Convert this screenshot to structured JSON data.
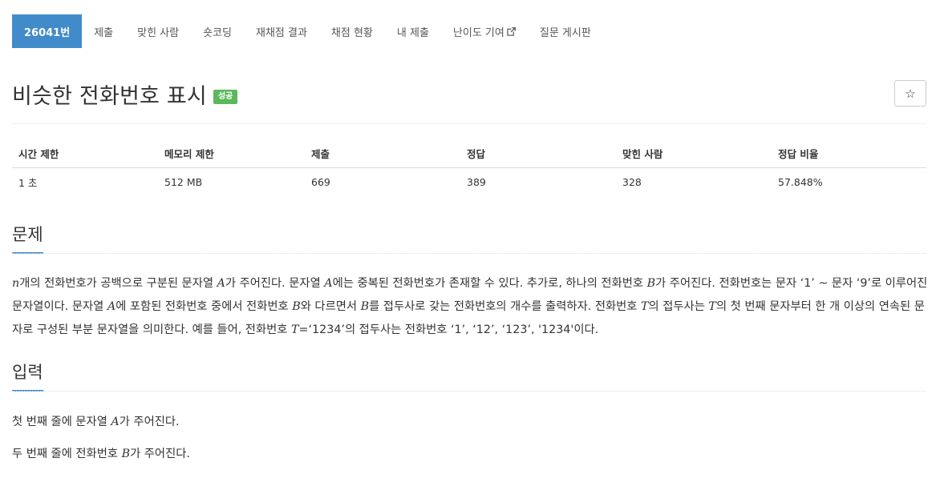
{
  "nav": {
    "items": [
      {
        "label": "26041번",
        "active": true
      },
      {
        "label": "제출"
      },
      {
        "label": "맞힌 사람"
      },
      {
        "label": "숏코딩"
      },
      {
        "label": "재채점 결과"
      },
      {
        "label": "채점 현황"
      },
      {
        "label": "내 제출"
      },
      {
        "label": "난이도 기여",
        "external": true
      },
      {
        "label": "질문 게시판"
      }
    ]
  },
  "problem": {
    "title": "비슷한 전화번호 표시",
    "status_badge": "성공",
    "star_icon": "star-outline-icon"
  },
  "info_table": {
    "headers": [
      "시간 제한",
      "메모리 제한",
      "제출",
      "정답",
      "맞힌 사람",
      "정답 비율"
    ],
    "row": [
      "1 초",
      "512 MB",
      "669",
      "389",
      "328",
      "57.848%"
    ]
  },
  "sections": {
    "description": {
      "heading": "문제",
      "text": {
        "t1": "개의 전화번호가 공백으로 구분된 문자열 ",
        "t2": "가 주어진다. 문자열 ",
        "t3": "에는 중복된 전화번호가 존재할 수 있다. 추가로, 하나의 전화번호 ",
        "t4": "가 주어진다. 전화번호는 문자 ‘1’ ~ 문자 ‘9’로 이루어진 문자열이다. 문자열 ",
        "t5": "에 포함된 전화번호 중에서 전화번호 ",
        "t6": "와 다르면서 ",
        "t7": "를 접두사로 갖는 전화번호의 개수를 출력하자. 전화번호 ",
        "t8": "의 접두사는 ",
        "t9": "의 첫 번째 문자부터 한 개 이상의 연속된 문자로 구성된 부분 문자열을 의미한다. 예를 들어, 전화번호 ",
        "t10": "=‘1234’의 접두사는 전화번호 ‘1’, ‘12’, ‘123’, '1234'이다.",
        "var_n": "n",
        "var_a": "A",
        "var_b": "B",
        "var_t": "T"
      }
    },
    "input": {
      "heading": "입력",
      "line1_a": "첫 번째 줄에 문자열 ",
      "line1_b": "가 주어진다.",
      "line2_a": "두 번째 줄에 전화번호 ",
      "line2_b": "가 주어진다.",
      "var_a": "A",
      "var_b": "B"
    }
  }
}
